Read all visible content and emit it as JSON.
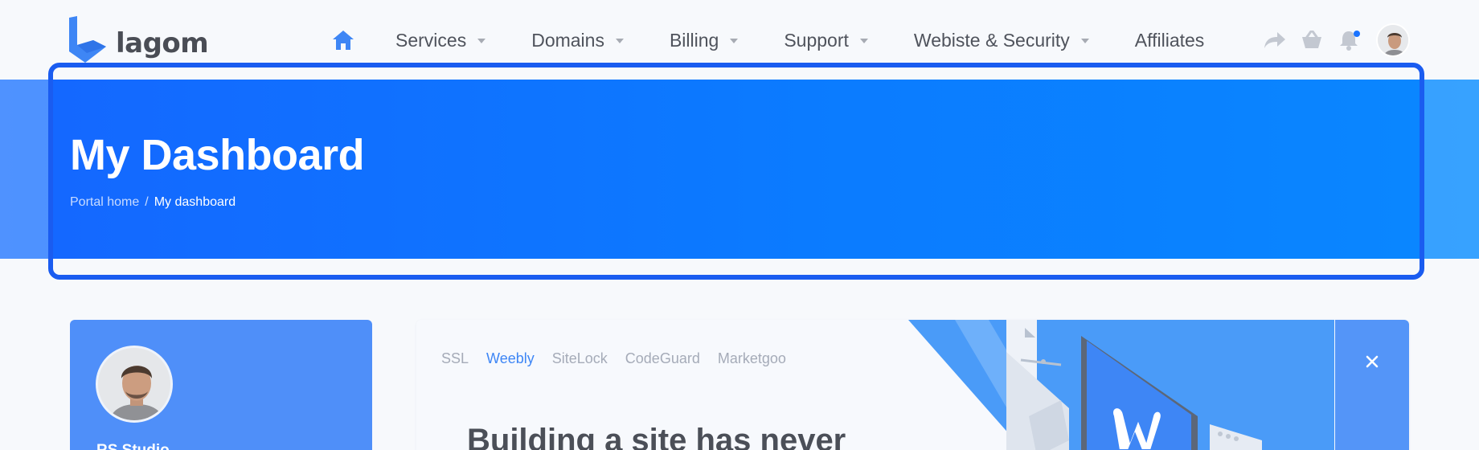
{
  "brand": {
    "name": "lagom",
    "color": "#3e86f5"
  },
  "nav": {
    "home_icon": "home-icon",
    "items": [
      {
        "label": "Services",
        "has_dropdown": true
      },
      {
        "label": "Domains",
        "has_dropdown": true
      },
      {
        "label": "Billing",
        "has_dropdown": true
      },
      {
        "label": "Support",
        "has_dropdown": true
      },
      {
        "label": "Webiste & Security",
        "has_dropdown": true
      },
      {
        "label": "Affiliates",
        "has_dropdown": false
      }
    ],
    "right_icons": [
      "share-icon",
      "basket-icon",
      "bell-icon",
      "avatar"
    ]
  },
  "hero": {
    "title": "My Dashboard",
    "breadcrumb": {
      "home": "Portal home",
      "separator": "/",
      "current": "My dashboard"
    },
    "colors": {
      "band": "#3b8bff",
      "inner": "#0b7bff",
      "frame": "#1a5cf0"
    }
  },
  "profile": {
    "name": "RS Studio"
  },
  "promo": {
    "tabs": [
      {
        "label": "SSL",
        "active": false
      },
      {
        "label": "Weebly",
        "active": true
      },
      {
        "label": "SiteLock",
        "active": false
      },
      {
        "label": "CodeGuard",
        "active": false
      },
      {
        "label": "Marketgoo",
        "active": false
      }
    ],
    "heading": "Building a site has never",
    "close_icon": "close-icon"
  }
}
